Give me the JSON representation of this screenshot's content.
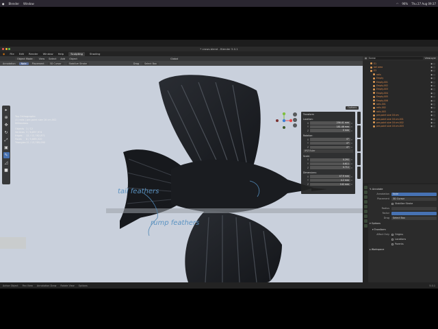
{
  "mac_menu": {
    "apple": "",
    "app": "Blender",
    "window": "Window",
    "status": [
      "96%",
      "Thu 27 Aug 09:37"
    ]
  },
  "window_title": "* crows.blend - Blender 5.0.1",
  "menus": [
    "File",
    "Edit",
    "Render",
    "Window",
    "Help"
  ],
  "workspaces": [
    {
      "label": "Sculpting",
      "active": true
    },
    {
      "label": "Shading",
      "active": false
    }
  ],
  "viewport_header": {
    "mode": "Object Mode",
    "items": [
      "View",
      "Select",
      "Add",
      "Object"
    ],
    "orientation": "Global",
    "options": "Options"
  },
  "tool_header": {
    "annotation_label": "Annotation",
    "annotation_value": "Note",
    "placement_label": "Placement",
    "placement_value": "3D Cursor",
    "stabilize": "Stabilize Stroke",
    "drag_label": "Drag",
    "drag_value": "Select Box"
  },
  "overlay": {
    "view": "Top Orthographic",
    "collection": "(1) rails | pre-point size 16 cm.002",
    "units": "Millimeters",
    "stats": [
      {
        "k": "Objects",
        "v": "1 / 12"
      },
      {
        "k": "Vertices",
        "v": "3 / 6,897,974"
      },
      {
        "k": "Edges",
        "v": "12 / 12,782,871"
      },
      {
        "k": "Faces",
        "v": "8 / 5,889,320"
      },
      {
        "k": "Triangles",
        "v": "12 / 13,785,090"
      }
    ]
  },
  "annotations": {
    "tail": "tail feathers",
    "rump": "rump feathers"
  },
  "npanel": {
    "title": "Transform",
    "location_label": "Location:",
    "location": [
      {
        "a": "X",
        "v": "256.41 mm"
      },
      {
        "a": "Y",
        "v": "181.46 mm"
      },
      {
        "a": "Z",
        "v": "0 mm"
      }
    ],
    "rotation_label": "Rotation:",
    "rotation": [
      {
        "a": "X",
        "v": "0°"
      },
      {
        "a": "Y",
        "v": "0°"
      },
      {
        "a": "Z",
        "v": "0°"
      }
    ],
    "rotation_mode": "XYZ Euler",
    "scale_label": "Scale:",
    "scale": [
      {
        "a": "X",
        "v": "0.291"
      },
      {
        "a": "Y",
        "v": "0.611"
      },
      {
        "a": "Z",
        "v": "0.711"
      }
    ],
    "dimensions_label": "Dimensions:",
    "dimensions": [
      {
        "a": "X",
        "v": "47.9 mm"
      },
      {
        "a": "Y",
        "v": "4.2 mm"
      },
      {
        "a": "Z",
        "v": "142 mm"
      }
    ]
  },
  "outliner": {
    "search": "Scene",
    "view_layer": "ViewLayer",
    "rows": [
      "E1",
      "tail area",
      "E3",
      "rails",
      "Empty",
      "Empty.001",
      "Empty.002",
      "Empty.003",
      "Empty.004",
      "Empty.005",
      "Empty.006",
      "rails.001",
      "rails.002",
      "rails.003",
      "pre-point size 16 cm",
      "pre-point size 16 cm.001",
      "pre-point size 16 cm.002",
      "pre-point size 16 cm.003"
    ]
  },
  "props": {
    "section": "Annotate",
    "annotation_label": "Annotation",
    "annotation_value": "Note",
    "placement_label": "Placement",
    "placement_value": "3D Cursor",
    "stabilize": "Stabilize Stroke",
    "radius_label": "Radius",
    "factor_label": "Factor",
    "drag_label": "Drag",
    "drag_value": "Select Box",
    "options": "Options",
    "transform": "Transform",
    "affect_only": "Affect Only",
    "origins": "Origins",
    "locations": "Locations",
    "parents": "Parents",
    "workspace": "Workspace"
  },
  "statusbar": {
    "items": [
      "Active Object",
      "Pan View",
      "Annotation Draw",
      "Rotate View",
      "Options"
    ],
    "version": "5.0.1"
  }
}
